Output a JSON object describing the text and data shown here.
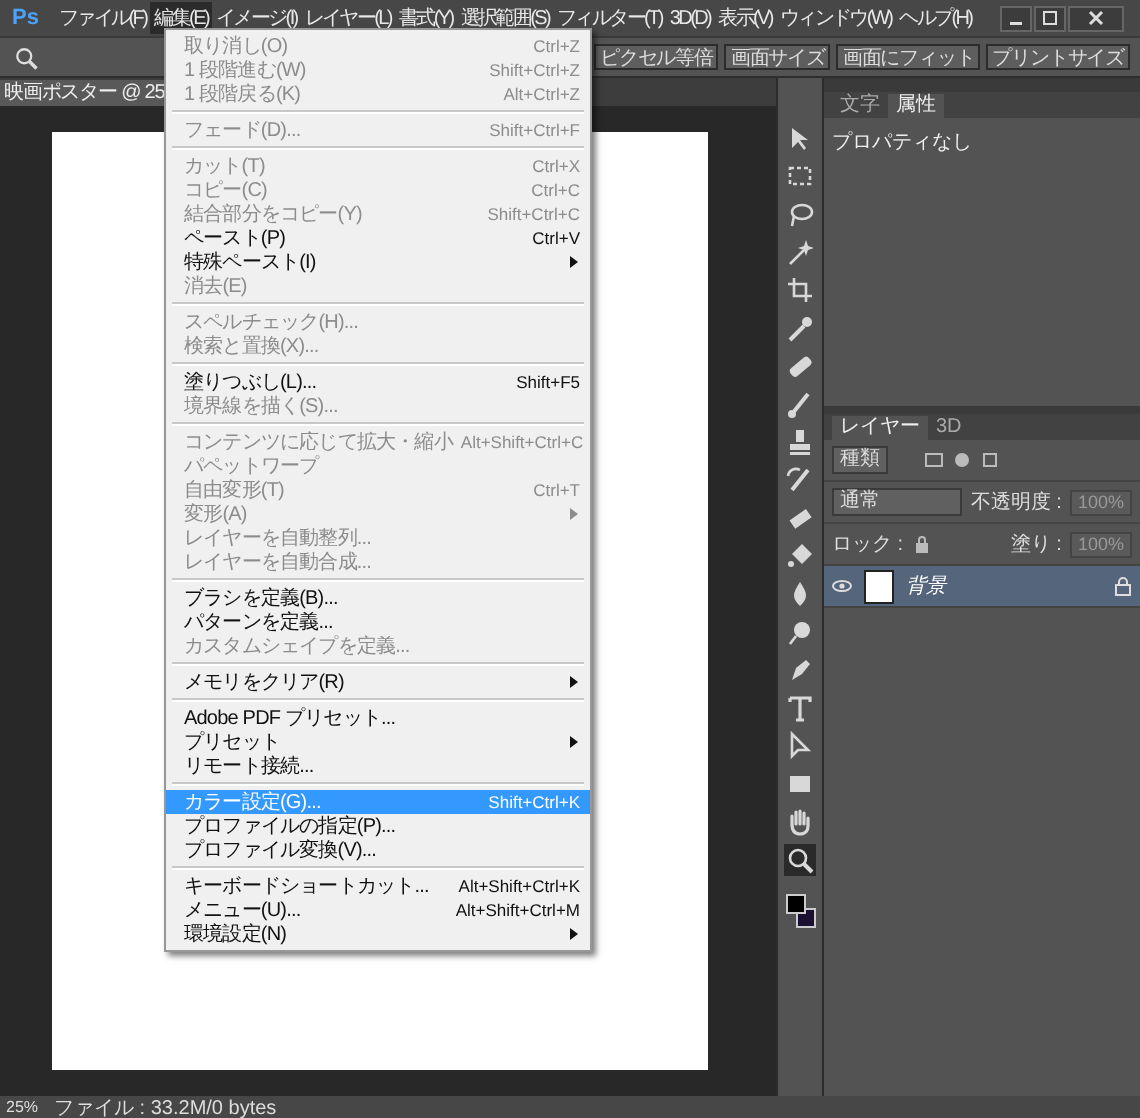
{
  "app_logo": "Ps",
  "menubar": [
    {
      "label": "ファイル(F)",
      "selected": false
    },
    {
      "label": "編集(E)",
      "selected": true
    },
    {
      "label": "イメージ(I)",
      "selected": false
    },
    {
      "label": "レイヤー(L)",
      "selected": false
    },
    {
      "label": "書式(Y)",
      "selected": false
    },
    {
      "label": "選択範囲(S)",
      "selected": false
    },
    {
      "label": "フィルター(T)",
      "selected": false
    },
    {
      "label": "3D(D)",
      "selected": false
    },
    {
      "label": "表示(V)",
      "selected": false
    },
    {
      "label": "ウィンドウ(W)",
      "selected": false
    },
    {
      "label": "ヘルプ(H)",
      "selected": false
    }
  ],
  "options_bar": {
    "buttons": [
      "ピクセル等倍",
      "画面サイズ",
      "画面にフィット",
      "プリントサイズ"
    ]
  },
  "document": {
    "tab_title": "映画ポスター @ 25"
  },
  "edit_menu": [
    {
      "kind": "item",
      "label": "取り消し(O)",
      "shortcut": "Ctrl+Z",
      "disabled": true,
      "submenu": false,
      "selected": false
    },
    {
      "kind": "item",
      "label": "1 段階進む(W)",
      "shortcut": "Shift+Ctrl+Z",
      "disabled": true,
      "submenu": false,
      "selected": false
    },
    {
      "kind": "item",
      "label": "1 段階戻る(K)",
      "shortcut": "Alt+Ctrl+Z",
      "disabled": true,
      "submenu": false,
      "selected": false
    },
    {
      "kind": "separator"
    },
    {
      "kind": "item",
      "label": "フェード(D)...",
      "shortcut": "Shift+Ctrl+F",
      "disabled": true,
      "submenu": false,
      "selected": false
    },
    {
      "kind": "separator"
    },
    {
      "kind": "item",
      "label": "カット(T)",
      "shortcut": "Ctrl+X",
      "disabled": true,
      "submenu": false,
      "selected": false
    },
    {
      "kind": "item",
      "label": "コピー(C)",
      "shortcut": "Ctrl+C",
      "disabled": true,
      "submenu": false,
      "selected": false
    },
    {
      "kind": "item",
      "label": "結合部分をコピー(Y)",
      "shortcut": "Shift+Ctrl+C",
      "disabled": true,
      "submenu": false,
      "selected": false
    },
    {
      "kind": "item",
      "label": "ペースト(P)",
      "shortcut": "Ctrl+V",
      "disabled": false,
      "submenu": false,
      "selected": false
    },
    {
      "kind": "item",
      "label": "特殊ペースト(I)",
      "disabled": false,
      "submenu": true,
      "selected": false
    },
    {
      "kind": "item",
      "label": "消去(E)",
      "disabled": true,
      "submenu": false,
      "selected": false
    },
    {
      "kind": "separator"
    },
    {
      "kind": "item",
      "label": "スペルチェック(H)...",
      "disabled": true,
      "submenu": false,
      "selected": false
    },
    {
      "kind": "item",
      "label": "検索と置換(X)...",
      "disabled": true,
      "submenu": false,
      "selected": false
    },
    {
      "kind": "separator"
    },
    {
      "kind": "item",
      "label": "塗りつぶし(L)...",
      "shortcut": "Shift+F5",
      "disabled": false,
      "submenu": false,
      "selected": false
    },
    {
      "kind": "item",
      "label": "境界線を描く(S)...",
      "disabled": true,
      "submenu": false,
      "selected": false
    },
    {
      "kind": "separator"
    },
    {
      "kind": "item",
      "label": "コンテンツに応じて拡大・縮小",
      "shortcut": "Alt+Shift+Ctrl+C",
      "disabled": true,
      "submenu": false,
      "selected": false
    },
    {
      "kind": "item",
      "label": "パペットワープ",
      "disabled": true,
      "submenu": false,
      "selected": false
    },
    {
      "kind": "item",
      "label": "自由変形(T)",
      "shortcut": "Ctrl+T",
      "disabled": true,
      "submenu": false,
      "selected": false
    },
    {
      "kind": "item",
      "label": "変形(A)",
      "disabled": true,
      "submenu": true,
      "selected": false
    },
    {
      "kind": "item",
      "label": "レイヤーを自動整列...",
      "disabled": true,
      "submenu": false,
      "selected": false
    },
    {
      "kind": "item",
      "label": "レイヤーを自動合成...",
      "disabled": true,
      "submenu": false,
      "selected": false
    },
    {
      "kind": "separator"
    },
    {
      "kind": "item",
      "label": "ブラシを定義(B)...",
      "disabled": false,
      "submenu": false,
      "selected": false
    },
    {
      "kind": "item",
      "label": "パターンを定義...",
      "disabled": false,
      "submenu": false,
      "selected": false
    },
    {
      "kind": "item",
      "label": "カスタムシェイプを定義...",
      "disabled": true,
      "submenu": false,
      "selected": false
    },
    {
      "kind": "separator"
    },
    {
      "kind": "item",
      "label": "メモリをクリア(R)",
      "disabled": false,
      "submenu": true,
      "selected": false
    },
    {
      "kind": "separator"
    },
    {
      "kind": "item",
      "label": "Adobe PDF プリセット...",
      "disabled": false,
      "submenu": false,
      "selected": false
    },
    {
      "kind": "item",
      "label": "プリセット",
      "disabled": false,
      "submenu": true,
      "selected": false
    },
    {
      "kind": "item",
      "label": "リモート接続...",
      "disabled": false,
      "submenu": false,
      "selected": false
    },
    {
      "kind": "separator"
    },
    {
      "kind": "item",
      "label": "カラー設定(G)...",
      "shortcut": "Shift+Ctrl+K",
      "disabled": false,
      "submenu": false,
      "selected": true
    },
    {
      "kind": "item",
      "label": "プロファイルの指定(P)...",
      "disabled": false,
      "submenu": false,
      "selected": false
    },
    {
      "kind": "item",
      "label": "プロファイル変換(V)...",
      "disabled": false,
      "submenu": false,
      "selected": false
    },
    {
      "kind": "separator"
    },
    {
      "kind": "item",
      "label": "キーボードショートカット...",
      "shortcut": "Alt+Shift+Ctrl+K",
      "disabled": false,
      "submenu": false,
      "selected": false
    },
    {
      "kind": "item",
      "label": "メニュー(U)...",
      "shortcut": "Alt+Shift+Ctrl+M",
      "disabled": false,
      "submenu": false,
      "selected": false
    },
    {
      "kind": "item",
      "label": "環境設定(N)",
      "disabled": false,
      "submenu": true,
      "selected": false
    }
  ],
  "tools": [
    {
      "kind": "move",
      "selected": false
    },
    {
      "kind": "marquee",
      "selected": false
    },
    {
      "kind": "lasso",
      "selected": false
    },
    {
      "kind": "wand",
      "selected": false
    },
    {
      "kind": "crop",
      "selected": false
    },
    {
      "kind": "eyedropper",
      "selected": false
    },
    {
      "kind": "bandage",
      "selected": false
    },
    {
      "kind": "brush",
      "selected": false
    },
    {
      "kind": "stamp",
      "selected": false
    },
    {
      "kind": "history",
      "selected": false
    },
    {
      "kind": "eraser",
      "selected": false
    },
    {
      "kind": "bucket",
      "selected": false
    },
    {
      "kind": "blur",
      "selected": false
    },
    {
      "kind": "dodge",
      "selected": false
    },
    {
      "kind": "pen",
      "selected": false
    },
    {
      "kind": "type",
      "selected": false
    },
    {
      "kind": "path",
      "selected": false
    },
    {
      "kind": "shape",
      "selected": false
    },
    {
      "kind": "hand",
      "selected": false
    },
    {
      "kind": "zoom",
      "selected": true
    }
  ],
  "properties_panel": {
    "tabs": [
      {
        "label": "文字",
        "selected": false
      },
      {
        "label": "属性",
        "selected": true
      }
    ],
    "message": "プロパティなし"
  },
  "layers_panel": {
    "tabs": [
      {
        "label": "レイヤー",
        "selected": true
      },
      {
        "label": "3D",
        "selected": false
      }
    ],
    "filter_kind": "種類",
    "blend_mode": "通常",
    "opacity_label": "不透明度 :",
    "opacity": "100%",
    "lock_label": "ロック :",
    "fill_label": "塗り :",
    "fill": "100%",
    "layers": [
      {
        "name": "背景",
        "visible": true,
        "selected": true,
        "locked": true
      }
    ]
  },
  "status_bar": {
    "zoom": "25%",
    "info": "ファイル : 33.2M/0 bytes"
  }
}
